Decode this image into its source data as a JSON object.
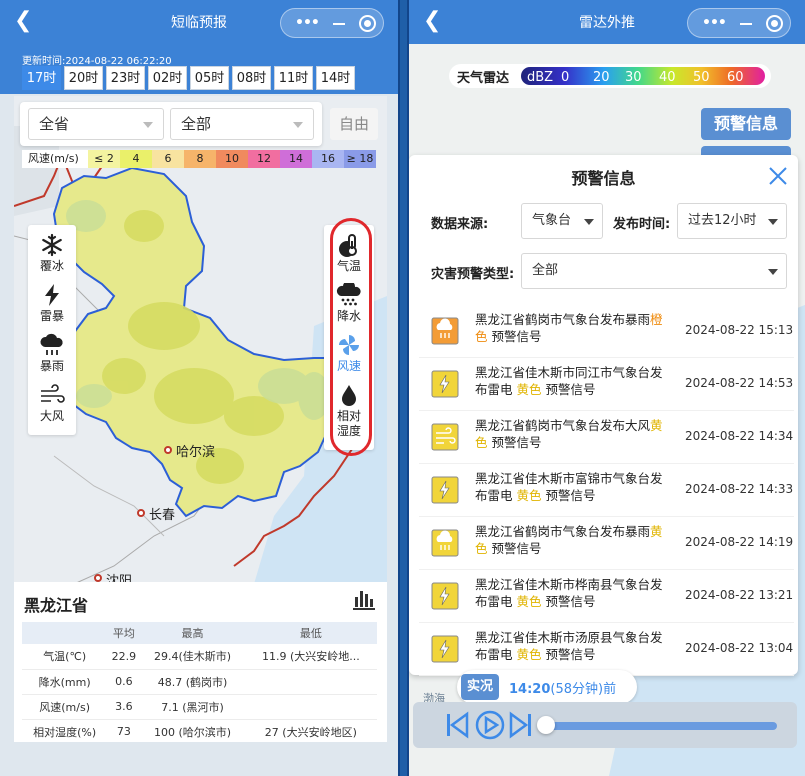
{
  "left": {
    "title": "短临预报",
    "update_time": "更新时间:2024-08-22 06:22:20",
    "time_tabs": [
      {
        "label": "17时",
        "active": true
      },
      {
        "label": "20时",
        "active": false
      },
      {
        "label": "23时",
        "active": false
      },
      {
        "label": "02时",
        "active": false
      },
      {
        "label": "05时",
        "active": false
      },
      {
        "label": "08时",
        "active": false
      },
      {
        "label": "11时",
        "active": false
      },
      {
        "label": "14时",
        "active": false
      }
    ],
    "filter": {
      "province": "全省",
      "area": "全部",
      "free_label": "自由"
    },
    "wind_legend": {
      "label": "风速(m/s)",
      "items": [
        {
          "label": "≤ 2",
          "color": "#f4f4a0"
        },
        {
          "label": "4",
          "color": "#eaf06a"
        },
        {
          "label": "6",
          "color": "#f8e3a0"
        },
        {
          "label": "8",
          "color": "#f6b46a"
        },
        {
          "label": "10",
          "color": "#f08a5e"
        },
        {
          "label": "12",
          "color": "#f16ea0"
        },
        {
          "label": "14",
          "color": "#cf6ed8"
        },
        {
          "label": "16",
          "color": "#a9b6f2"
        },
        {
          "label": "≥ 18",
          "color": "#8a9be8"
        }
      ]
    },
    "left_tools": [
      {
        "label": "覆冰",
        "icon": "snowflake-icon"
      },
      {
        "label": "雷暴",
        "icon": "lightning-icon"
      },
      {
        "label": "暴雨",
        "icon": "rain-cloud-icon"
      },
      {
        "label": "大风",
        "icon": "wind-icon"
      }
    ],
    "right_tools": [
      {
        "label": "气温",
        "icon": "thermometer-icon"
      },
      {
        "label": "降水",
        "icon": "precipitation-icon"
      },
      {
        "label": "风速",
        "icon": "pinwheel-icon",
        "active": true
      },
      {
        "label": "相对\n湿度",
        "icon": "droplet-icon"
      }
    ],
    "cities": [
      {
        "name": "哈尔滨"
      },
      {
        "name": "长春"
      },
      {
        "name": "沈阳"
      }
    ],
    "stats": {
      "province": "黑龙江省",
      "headers": [
        "",
        "平均",
        "最高",
        "最低"
      ],
      "rows": [
        [
          "气温(℃)",
          "22.9",
          "29.4(佳木斯市)",
          "11.9 (大兴安岭地..."
        ],
        [
          "降水(mm)",
          "0.6",
          "48.7 (鹤岗市)",
          ""
        ],
        [
          "风速(m/s)",
          "3.6",
          "7.1 (黑河市)",
          ""
        ],
        [
          "相对湿度(%)",
          "73",
          "100 (哈尔滨市)",
          "27 (大兴安岭地区)"
        ]
      ]
    }
  },
  "right": {
    "title": "雷达外推",
    "radar_legend": {
      "title": "天气雷达",
      "unit": "dBZ",
      "values": [
        "0",
        "20",
        "30",
        "40",
        "50",
        "60"
      ]
    },
    "alert_button": "预警信息",
    "panel": {
      "title": "预警信息",
      "source_label": "数据来源:",
      "source_value": "气象台",
      "time_label": "发布时间:",
      "time_value": "过去12小时",
      "type_label": "灾害预警类型:",
      "type_value": "全部",
      "warnings": [
        {
          "line1": "黑龙江省鹤岗市气象台发布暴雨",
          "level": "橙",
          "line2a": "色",
          "line2b": " 预警信号",
          "orange": true,
          "kind": "rain",
          "time": "2024-08-22 15:13"
        },
        {
          "line1": "黑龙江省佳木斯市同江市气象台发",
          "line2pre": "布雷电 ",
          "level": "黄色",
          "line2b": " 预警信号",
          "orange": false,
          "kind": "thunder",
          "time": "2024-08-22 14:53"
        },
        {
          "line1": "黑龙江省鹤岗市气象台发布大风",
          "level": "黄",
          "line2a": "色",
          "line2b": " 预警信号",
          "orange": false,
          "kind": "wind",
          "time": "2024-08-22 14:34"
        },
        {
          "line1": "黑龙江省佳木斯市富锦市气象台发",
          "line2pre": "布雷电 ",
          "level": "黄色",
          "line2b": " 预警信号",
          "orange": false,
          "kind": "thunder",
          "time": "2024-08-22 14:33"
        },
        {
          "line1": "黑龙江省鹤岗市气象台发布暴雨",
          "level": "黄",
          "line2a": "色",
          "line2b": " 预警信号",
          "orange": false,
          "kind": "rain",
          "time": "2024-08-22 14:19"
        },
        {
          "line1": "黑龙江省佳木斯市桦南县气象台发",
          "line2pre": "布雷电 ",
          "level": "黄色",
          "line2b": " 预警信号",
          "orange": false,
          "kind": "thunder",
          "time": "2024-08-22 13:21"
        },
        {
          "line1": "黑龙江省佳木斯市汤原县气象台发",
          "line2pre": "布雷电 ",
          "level": "黄色",
          "line2b": " 预警信号",
          "orange": false,
          "kind": "thunder",
          "time": "2024-08-22 13:04"
        }
      ]
    },
    "live": {
      "tag": "实况",
      "time": "14:20",
      "ago": "(58分钟)前"
    },
    "map_label": "渤海"
  }
}
